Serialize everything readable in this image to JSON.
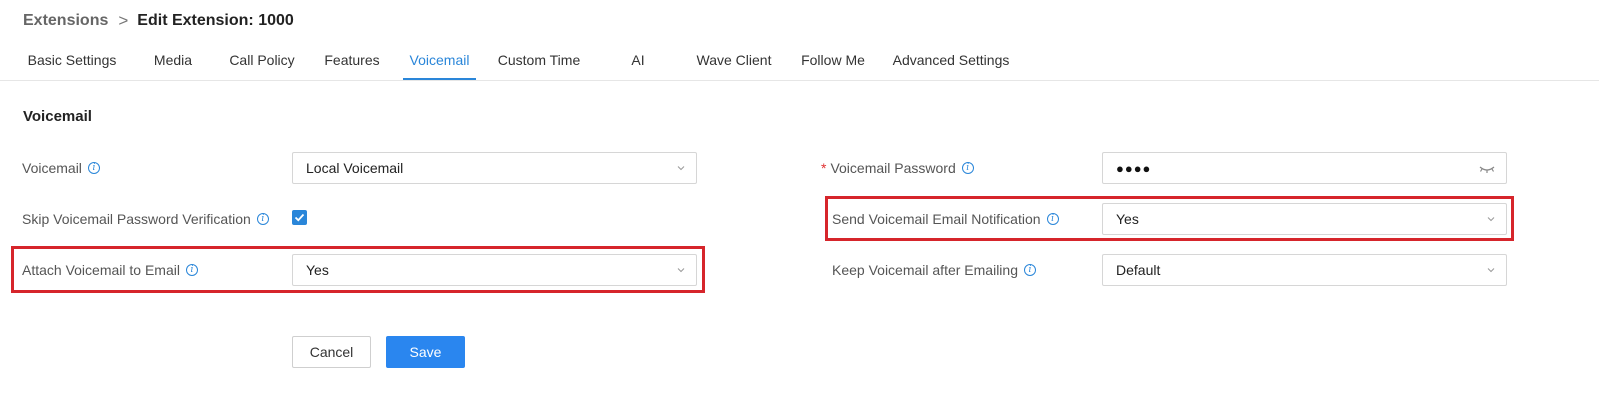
{
  "breadcrumb": {
    "parent": "Extensions",
    "separator": ">",
    "current": "Edit Extension: 1000"
  },
  "tabs": [
    {
      "label": "Basic Settings",
      "active": false
    },
    {
      "label": "Media",
      "active": false
    },
    {
      "label": "Call Policy",
      "active": false
    },
    {
      "label": "Features",
      "active": false
    },
    {
      "label": "Voicemail",
      "active": true
    },
    {
      "label": "Custom Time",
      "active": false
    },
    {
      "label": "AI",
      "active": false
    },
    {
      "label": "Wave Client",
      "active": false
    },
    {
      "label": "Follow Me",
      "active": false
    },
    {
      "label": "Advanced Settings",
      "active": false
    }
  ],
  "section": {
    "title": "Voicemail"
  },
  "fields": {
    "voicemail": {
      "label": "Voicemail",
      "value": "Local Voicemail",
      "icon": "info-icon"
    },
    "skip_password": {
      "label": "Skip Voicemail Password Verification",
      "checked": true,
      "icon": "info-icon"
    },
    "attach_email": {
      "label": "Attach Voicemail to Email",
      "value": "Yes",
      "icon": "info-icon",
      "highlighted": true
    },
    "password": {
      "label": "Voicemail Password",
      "required_mark": "*",
      "value": "●●●●",
      "icon": "info-icon",
      "toggle_icon": "eye-closed-icon"
    },
    "send_notification": {
      "label": "Send Voicemail Email Notification",
      "value": "Yes",
      "icon": "info-icon",
      "highlighted": true
    },
    "keep_after_email": {
      "label": "Keep Voicemail after Emailing",
      "value": "Default",
      "icon": "info-icon"
    }
  },
  "buttons": {
    "cancel": "Cancel",
    "save": "Save"
  },
  "colors": {
    "accent": "#2a86d9",
    "save_button": "#2a86ef",
    "highlight_box": "#d6252b",
    "required": "#e03131"
  }
}
